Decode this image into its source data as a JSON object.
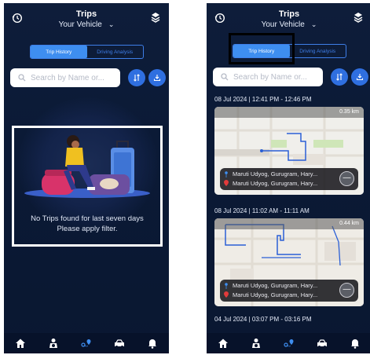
{
  "left": {
    "header": {
      "title": "Trips",
      "vehicle": "Your Vehicle"
    },
    "tabs": [
      {
        "label": "Trip History",
        "active": true
      },
      {
        "label": "Driving Analysis",
        "active": false
      }
    ],
    "search": {
      "placeholder": "Search by Name or..."
    },
    "empty_state": {
      "line1": "No Trips found for last seven days",
      "line2": "Please apply filter."
    }
  },
  "right": {
    "header": {
      "title": "Trips",
      "vehicle": "Your Vehicle"
    },
    "tabs": [
      {
        "label": "Trip History",
        "active": true
      },
      {
        "label": "Driving Analysis",
        "active": false
      }
    ],
    "search": {
      "placeholder": "Search by Name or..."
    },
    "trips": [
      {
        "date": "08 Jul 2024 | 12:41 PM - 12:46 PM",
        "distance": "0.35 km",
        "from": "Maruti Udyog, Gurugram, Hary...",
        "to": "Maruti Udyog, Gurugram, Hary..."
      },
      {
        "date": "08 Jul 2024 | 11:02 AM - 11:11 AM",
        "distance": "0.44 km",
        "from": "Maruti Udyog, Gurugram, Hary...",
        "to": "Maruti Udyog, Gurugram, Hary..."
      },
      {
        "date": "04 Jul 2024 | 03:07 PM - 03:16 PM"
      }
    ]
  },
  "nav": [
    "home-icon",
    "driver-icon",
    "location-icon",
    "car-wash-icon",
    "notification-icon"
  ],
  "colors": {
    "background": "#0e1d3a",
    "accent": "#3e8ef0",
    "navbar": "#07122a",
    "route": "#2a5fd6"
  }
}
